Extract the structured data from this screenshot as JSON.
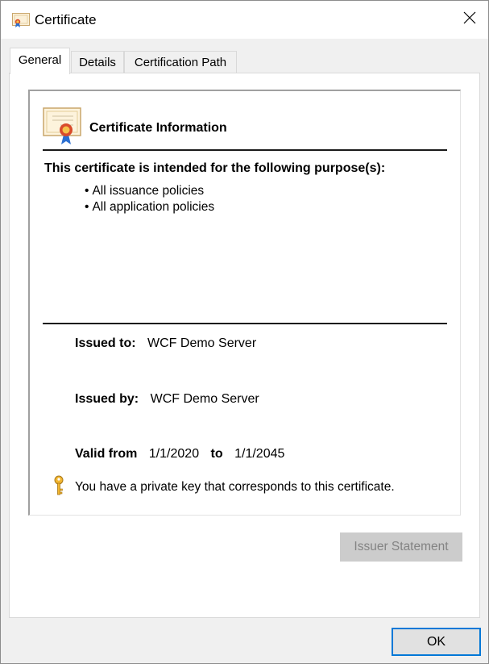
{
  "window": {
    "title": "Certificate",
    "title_icon": "certificate-icon",
    "close_icon": "close-icon"
  },
  "tabs": [
    {
      "label": "General",
      "active": true
    },
    {
      "label": "Details",
      "active": false
    },
    {
      "label": "Certification Path",
      "active": false
    }
  ],
  "general": {
    "heading": "Certificate Information",
    "purpose_heading": "This certificate is intended for the following purpose(s):",
    "purposes": [
      "All issuance policies",
      "All application policies"
    ],
    "issued_to_label": "Issued to:",
    "issued_to_value": "WCF Demo Server",
    "issued_by_label": "Issued by:",
    "issued_by_value": "WCF Demo Server",
    "valid_from_label": "Valid from",
    "valid_from_value": "1/1/2020",
    "valid_to_label": "to",
    "valid_to_value": "1/1/2045",
    "private_key_text": "You have a private key that corresponds to this certificate.",
    "key_icon": "key-icon"
  },
  "buttons": {
    "issuer_statement": "Issuer Statement",
    "issuer_statement_enabled": false,
    "ok": "OK"
  },
  "colors": {
    "focus_border": "#0078d7",
    "disabled_button_bg": "#cccccc",
    "disabled_button_text": "#838383"
  }
}
